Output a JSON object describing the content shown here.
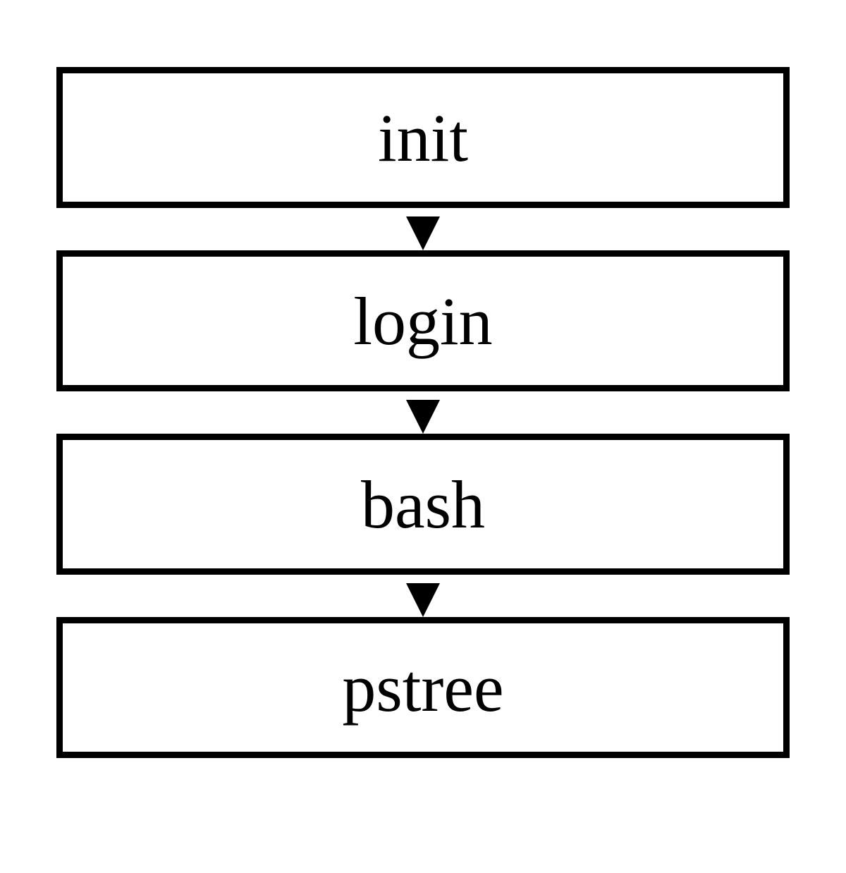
{
  "diagram": {
    "nodes": [
      {
        "label": "init"
      },
      {
        "label": "login"
      },
      {
        "label": "bash"
      },
      {
        "label": "pstree"
      }
    ]
  }
}
